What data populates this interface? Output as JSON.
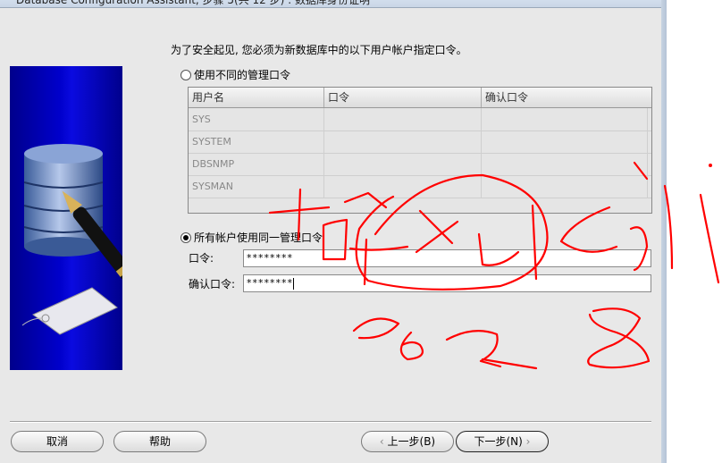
{
  "window": {
    "title": "Database Configuration Assistant, 步骤 5(共 12 步) : 数据库身份证明"
  },
  "intro_text": "为了安全起见, 您必须为新数据库中的以下用户帐户指定口令。",
  "options": {
    "different": "使用不同的管理口令",
    "same": "所有帐户使用同一管理口令"
  },
  "table": {
    "headers": [
      "用户名",
      "口令",
      "确认口令"
    ],
    "rows": [
      {
        "user": "SYS",
        "password": "",
        "confirm": ""
      },
      {
        "user": "SYSTEM",
        "password": "",
        "confirm": ""
      },
      {
        "user": "DBSNMP",
        "password": "",
        "confirm": ""
      },
      {
        "user": "SYSMAN",
        "password": "",
        "confirm": ""
      }
    ]
  },
  "fields": {
    "password_label": "口令:",
    "password_value": "********",
    "confirm_label": "确认口令:",
    "confirm_value": "********"
  },
  "buttons": {
    "cancel": "取消",
    "help": "帮助",
    "back": "上一步(B)",
    "next": "下一步(N)"
  },
  "colors": {
    "banner": "#0000cc",
    "scribble": "#ff0000"
  }
}
